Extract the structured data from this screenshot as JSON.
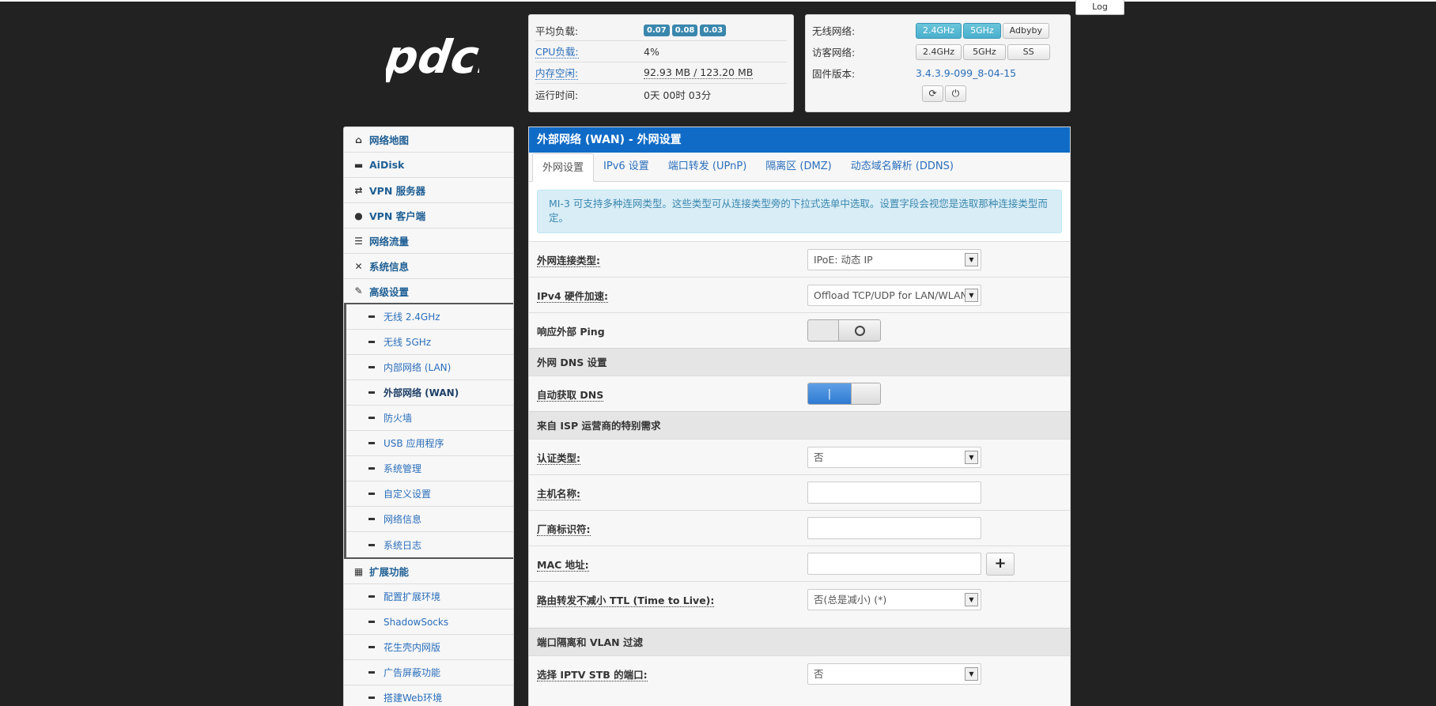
{
  "header": {
    "log_label": "Log",
    "logo_text": "pdcn"
  },
  "status": {
    "load_label": "平均负载:",
    "load_values": [
      "0.07",
      "0.08",
      "0.03"
    ],
    "cpu_label": "CPU负载:",
    "cpu_value": "4%",
    "mem_label": "内存空闲:",
    "mem_value": "92.93 MB / 123.20 MB",
    "uptime_label": "运行时间:",
    "uptime_value": "0天 00时 03分"
  },
  "wireless": {
    "wifi_label": "无线网络:",
    "wifi_buttons": [
      "2.4GHz",
      "5GHz",
      "Adbyby"
    ],
    "guest_label": "访客网络:",
    "guest_buttons": [
      "2.4GHz",
      "5GHz",
      "SS"
    ],
    "firmware_label": "固件版本:",
    "firmware_value": "3.4.3.9-099_8-04-15"
  },
  "sidebar": {
    "items": [
      {
        "label": "网络地图"
      },
      {
        "label": "AiDisk"
      },
      {
        "label": "VPN 服务器"
      },
      {
        "label": "VPN 客户端"
      },
      {
        "label": "网络流量"
      },
      {
        "label": "系统信息"
      },
      {
        "label": "高级设置"
      }
    ],
    "advanced_sub": [
      "无线 2.4GHz",
      "无线 5GHz",
      "内部网络 (LAN)",
      "外部网络 (WAN)",
      "防火墙",
      "USB 应用程序",
      "系统管理",
      "自定义设置",
      "网络信息",
      "系统日志"
    ],
    "ext_label": "扩展功能",
    "ext_sub": [
      "配置扩展环境",
      "ShadowSocks",
      "花生壳内网版",
      "广告屏蔽功能",
      "搭建Web环境"
    ]
  },
  "main": {
    "title": "外部网络 (WAN) - 外网设置",
    "tabs": [
      "外网设置",
      "IPv6 设置",
      "端口转发 (UPnP)",
      "隔离区 (DMZ)",
      "动态域名解析 (DDNS)"
    ],
    "info": "MI-3 可支持多种连网类型。这些类型可从连接类型旁的下拉式选单中选取。设置字段会视您是选取那种连接类型而定。",
    "wan_type_label": "外网连接类型:",
    "wan_type_value": "IPoE: 动态 IP",
    "hw_accel_label": "IPv4 硬件加速:",
    "hw_accel_value": "Offload TCP/UDP for LAN/WLAN",
    "ping_label": "响应外部 Ping",
    "dns_section": "外网 DNS 设置",
    "auto_dns_label": "自动获取 DNS",
    "isp_section": "来自 ISP 运营商的特别需求",
    "auth_label": "认证类型:",
    "auth_value": "否",
    "hostname_label": "主机名称:",
    "vendor_label": "厂商标识符:",
    "mac_label": "MAC 地址:",
    "ttl_label": "路由转发不减小 TTL (Time to Live):",
    "ttl_value": "否(总是减小) (*)",
    "vlan_section": "端口隔离和 VLAN 过滤",
    "iptv_label": "选择 IPTV STB 的端口:",
    "iptv_value": "否"
  }
}
